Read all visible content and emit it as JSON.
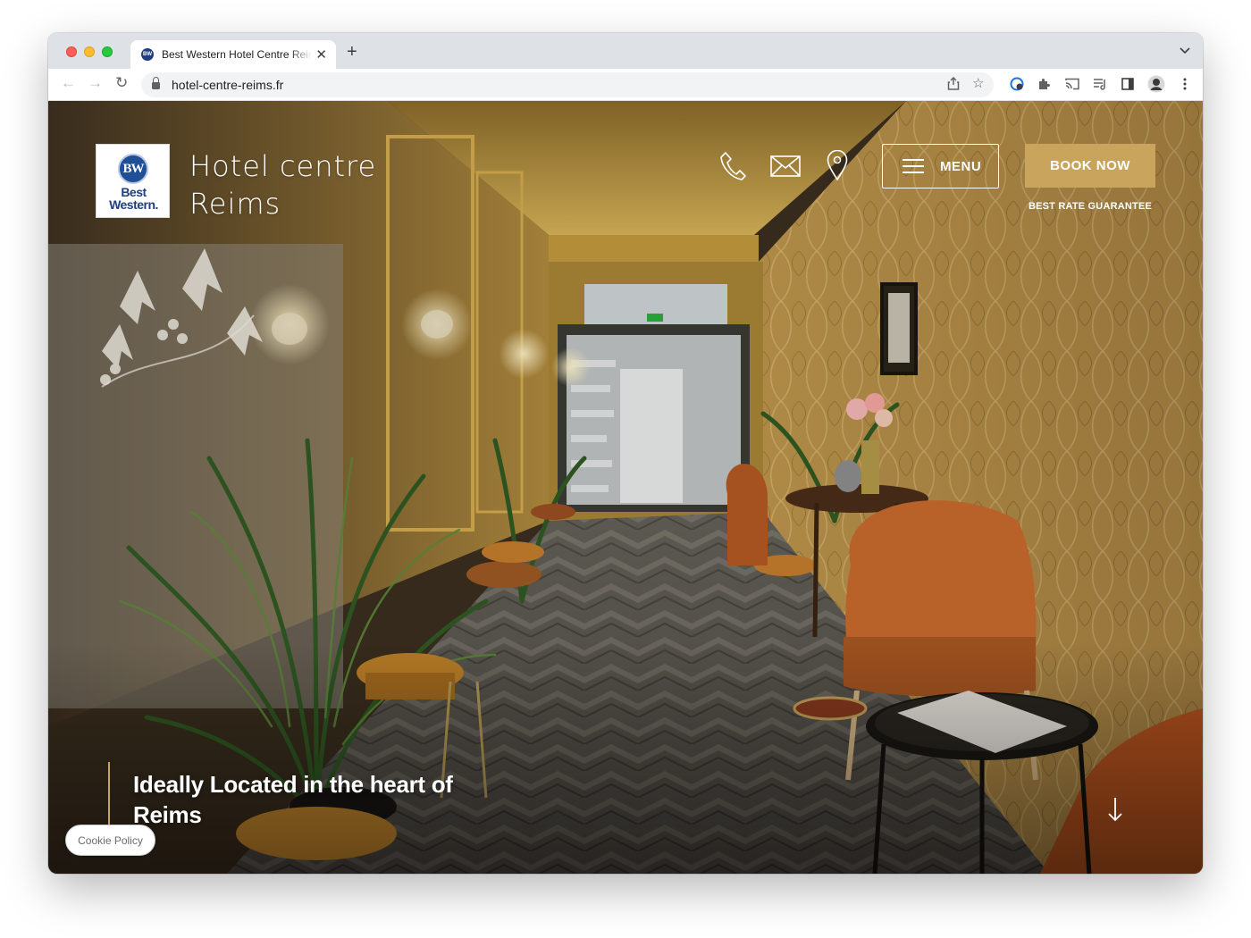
{
  "browser": {
    "tab": {
      "title": "Best Western Hotel Centre Reims",
      "favicon_text": "BW"
    },
    "new_tab_label": "+",
    "address": "hotel-centre-reims.fr"
  },
  "header": {
    "logo": {
      "badge": "BW",
      "line1": "Best",
      "line2": "Western."
    },
    "brand": {
      "line1": "Hotel centre",
      "line2": "Reims"
    },
    "menu_label": "MENU",
    "book_label": "BOOK NOW",
    "rate_guarantee": "BEST RATE GUARANTEE"
  },
  "hero": {
    "tagline": "Ideally Located in the heart of Reims"
  },
  "cookie": {
    "label": "Cookie Policy"
  },
  "colors": {
    "accent_gold": "#c9a45c",
    "bw_blue": "#1f3f7f",
    "chair_orange": "#c86a2c"
  }
}
